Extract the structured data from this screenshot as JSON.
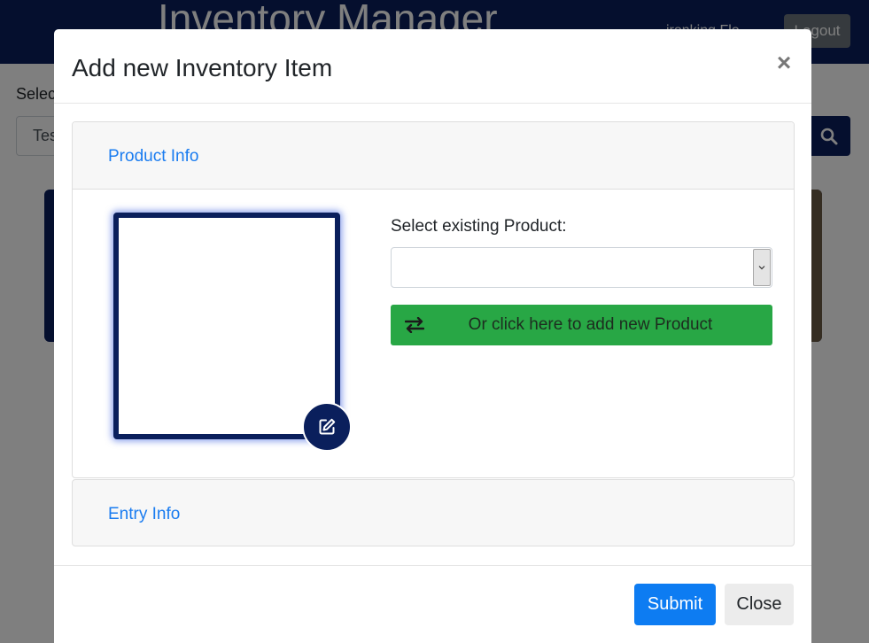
{
  "background": {
    "navbar_title": "Inventory Manager",
    "user_name": "ironking Flo",
    "logout_label": "Logout",
    "select_label": "Select",
    "search_value": "Test",
    "colors": {
      "navbar": "#0a1f5c"
    }
  },
  "modal": {
    "title": "Add new Inventory Item",
    "close_symbol": "×",
    "product_section": {
      "header_label": "Product Info",
      "select_label": "Select existing Product:",
      "select_value": "",
      "add_new_label": "Or click here to add new Product",
      "add_new_icon": "swap-arrows-icon",
      "image_edit_icon": "edit-icon"
    },
    "entry_section": {
      "header_label": "Entry Info"
    },
    "footer": {
      "submit_label": "Submit",
      "close_label": "Close"
    },
    "colors": {
      "primary": "#0d7cf2",
      "success": "#28a745",
      "navy": "#0a1f5c",
      "link": "#1a7cf0"
    }
  }
}
